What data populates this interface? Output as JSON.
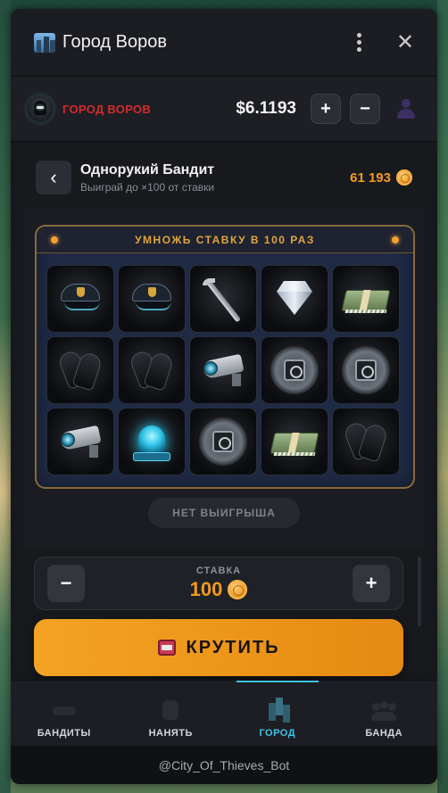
{
  "window": {
    "title": "Город Воров"
  },
  "header": {
    "brand": "ГОРОД ВОРОВ",
    "balance": "$6.1193",
    "plus_label": "+",
    "minus_label": "−"
  },
  "game": {
    "back_label": "‹",
    "title": "Однорукий Бандит",
    "subtitle": "Выиграй до ×100 от ставки",
    "coins": "61 193"
  },
  "machine": {
    "banner": "УМНОЖЬ СТАВКУ В 100 РАЗ",
    "reels": [
      [
        "police-cap",
        "police-cap",
        "crowbar",
        "diamond",
        "money-stack"
      ],
      [
        "gloves",
        "gloves",
        "security-camera",
        "safe",
        "safe"
      ],
      [
        "security-camera",
        "siren",
        "safe",
        "money-stack",
        "gloves"
      ]
    ]
  },
  "result": "НЕТ ВЫИГРЫША",
  "stake": {
    "label": "СТАВКА",
    "value": "100",
    "minus_label": "−",
    "plus_label": "+"
  },
  "spin": {
    "label": "КРУТИТЬ"
  },
  "nav": [
    {
      "label": "БАНДИТЫ",
      "icon": "mask-icon",
      "active": false
    },
    {
      "label": "НАНЯТЬ",
      "icon": "fist-icon",
      "active": false
    },
    {
      "label": "ГОРОД",
      "icon": "city-icon",
      "active": true
    },
    {
      "label": "БАНДА",
      "icon": "gang-icon",
      "active": false
    }
  ],
  "footer": "@City_Of_Thieves_Bot",
  "colors": {
    "accent_orange": "#f29a1a",
    "accent_cyan": "#3cc4e6",
    "brand_red": "#d42a2a"
  }
}
